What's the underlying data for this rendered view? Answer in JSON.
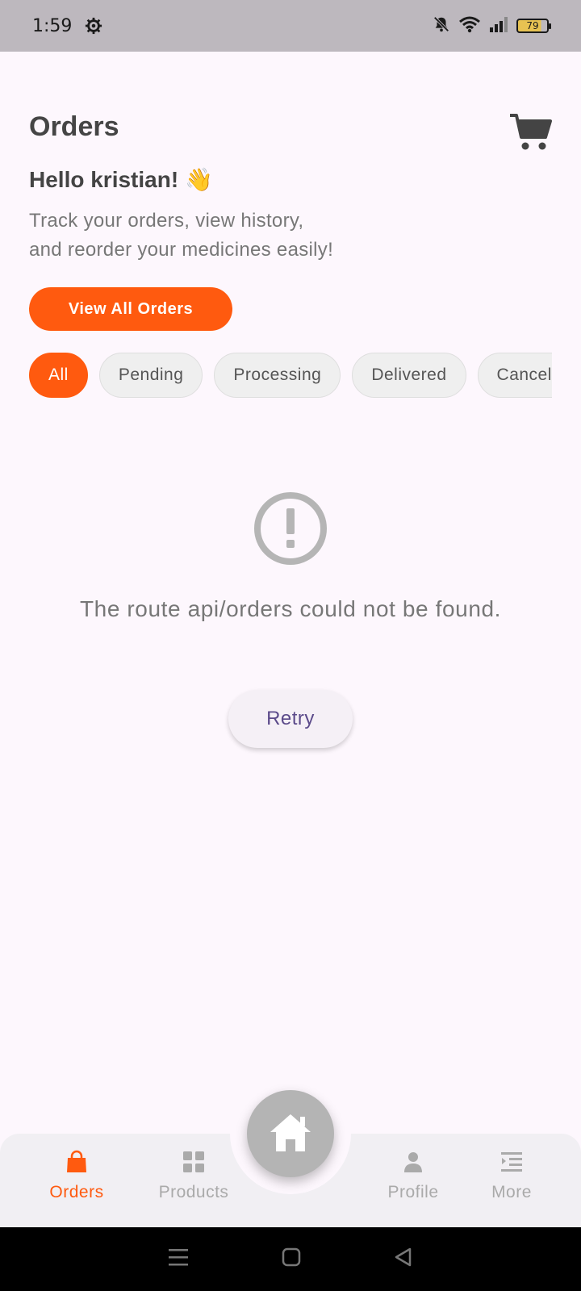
{
  "status_bar": {
    "time": "1:59",
    "battery": "79"
  },
  "header": {
    "title": "Orders"
  },
  "greeting": "Hello kristian! 👋",
  "subtitle_line1": "Track your orders, view history,",
  "subtitle_line2": "and reorder your medicines easily!",
  "view_all_label": "View All Orders",
  "filters": [
    {
      "label": "All",
      "active": true
    },
    {
      "label": "Pending",
      "active": false
    },
    {
      "label": "Processing",
      "active": false
    },
    {
      "label": "Delivered",
      "active": false
    },
    {
      "label": "Cancelled",
      "active": false
    }
  ],
  "error": {
    "message": "The route api/orders could not be found.",
    "retry_label": "Retry"
  },
  "bottom_nav": [
    {
      "label": "Orders",
      "icon": "bag-icon",
      "active": true
    },
    {
      "label": "Products",
      "icon": "grid-icon",
      "active": false
    },
    {
      "label": "Profile",
      "icon": "person-icon",
      "active": false
    },
    {
      "label": "More",
      "icon": "menu-list-icon",
      "active": false
    }
  ],
  "colors": {
    "accent": "#ff5a0f",
    "background": "#fdf7fd",
    "inactive": "#aaaaaa"
  }
}
